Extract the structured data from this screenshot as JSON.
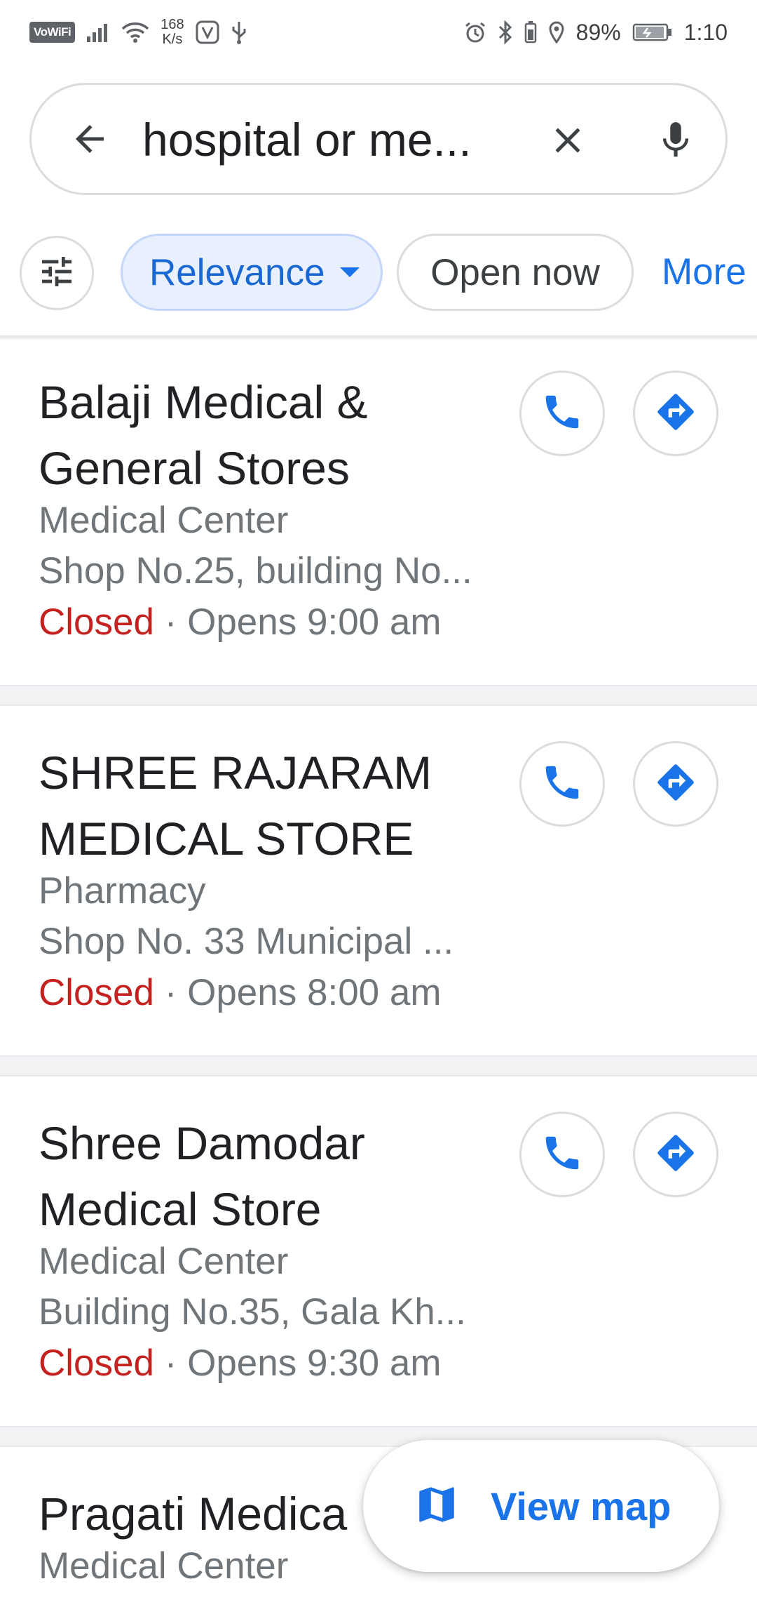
{
  "status_bar": {
    "vowifi": "VoWiFi",
    "speed_value": "168",
    "speed_unit": "K/s",
    "battery_pct": "89%",
    "time": "1:10"
  },
  "search": {
    "query": "hospital or me..."
  },
  "filters": {
    "relevance": "Relevance",
    "open_now": "Open now",
    "more": "More"
  },
  "results": [
    {
      "name_line1": "Balaji Medical &",
      "name_line2": "General Stores",
      "category": "Medical Center",
      "address": "Shop No.25, building No...",
      "status": "Closed",
      "separator": "·",
      "hours": "Opens 9:00 am"
    },
    {
      "name_line1": "SHREE RAJARAM",
      "name_line2": "MEDICAL STORE",
      "category": "Pharmacy",
      "address": "Shop No. 33 Municipal ...",
      "status": "Closed",
      "separator": "·",
      "hours": "Opens 8:00 am"
    },
    {
      "name_line1": "Shree Damodar",
      "name_line2": "Medical Store",
      "category": "Medical Center",
      "address": "Building No.35, Gala Kh...",
      "status": "Closed",
      "separator": "·",
      "hours": "Opens 9:30 am"
    },
    {
      "name_line1": "Pragati Medica",
      "category": "Medical Center"
    }
  ],
  "view_map": {
    "label": "View map"
  },
  "colors": {
    "accent": "#1a73e8",
    "closed": "#c5221f",
    "secondary_text": "#70757a"
  }
}
